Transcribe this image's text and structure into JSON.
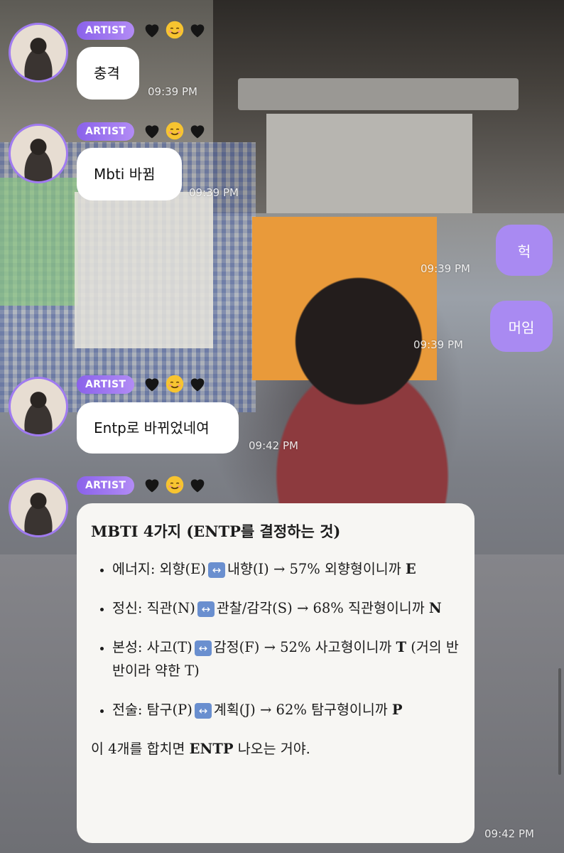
{
  "artist_badge": "ARTIST",
  "messages": [
    {
      "sender": "artist",
      "text": "충격",
      "time": "09:39 PM"
    },
    {
      "sender": "artist",
      "text": "Mbti 바뀜",
      "time": "09:39 PM"
    },
    {
      "sender": "me",
      "text": "헉",
      "time": "09:39 PM"
    },
    {
      "sender": "me",
      "text": "머임",
      "time": "09:39 PM"
    },
    {
      "sender": "artist",
      "text": "Entp로 바뀌었네여",
      "time": "09:42 PM"
    }
  ],
  "card": {
    "title": "MBTI 4가지 (ENTP를 결정하는 것)",
    "items": [
      {
        "label": "에너지:",
        "left": "외향(E)",
        "right": "내향(I)",
        "result": "→ 57% 외향형이니까",
        "letter": "E",
        "note": ""
      },
      {
        "label": "정신:",
        "left": "직관(N)",
        "right": "관찰/감각(S)",
        "result": "→ 68% 직관형이니까",
        "letter": "N",
        "note": ""
      },
      {
        "label": "본성:",
        "left": "사고(T)",
        "right": "감정(F)",
        "result": "→ 52% 사고형이니까",
        "letter": "T",
        "note": "(거의 반반이라 약한 T)"
      },
      {
        "label": "전술:",
        "left": "탐구(P)",
        "right": "계획(J)",
        "result": "→ 62% 탐구형이니까",
        "letter": "P",
        "note": ""
      }
    ],
    "summary_pre": "이 4개를 합치면",
    "summary_bold": "ENTP",
    "summary_post": "나오는 거야.",
    "time": "09:42 PM"
  },
  "colors": {
    "badge": "#8a62ea",
    "outgoing_bubble": "#a98af2",
    "avatar_ring": "#a07bf0"
  },
  "icons": [
    "black-heart-icon",
    "smiling-face-icon",
    "black-heart-icon",
    "swap-arrow-icon"
  ]
}
